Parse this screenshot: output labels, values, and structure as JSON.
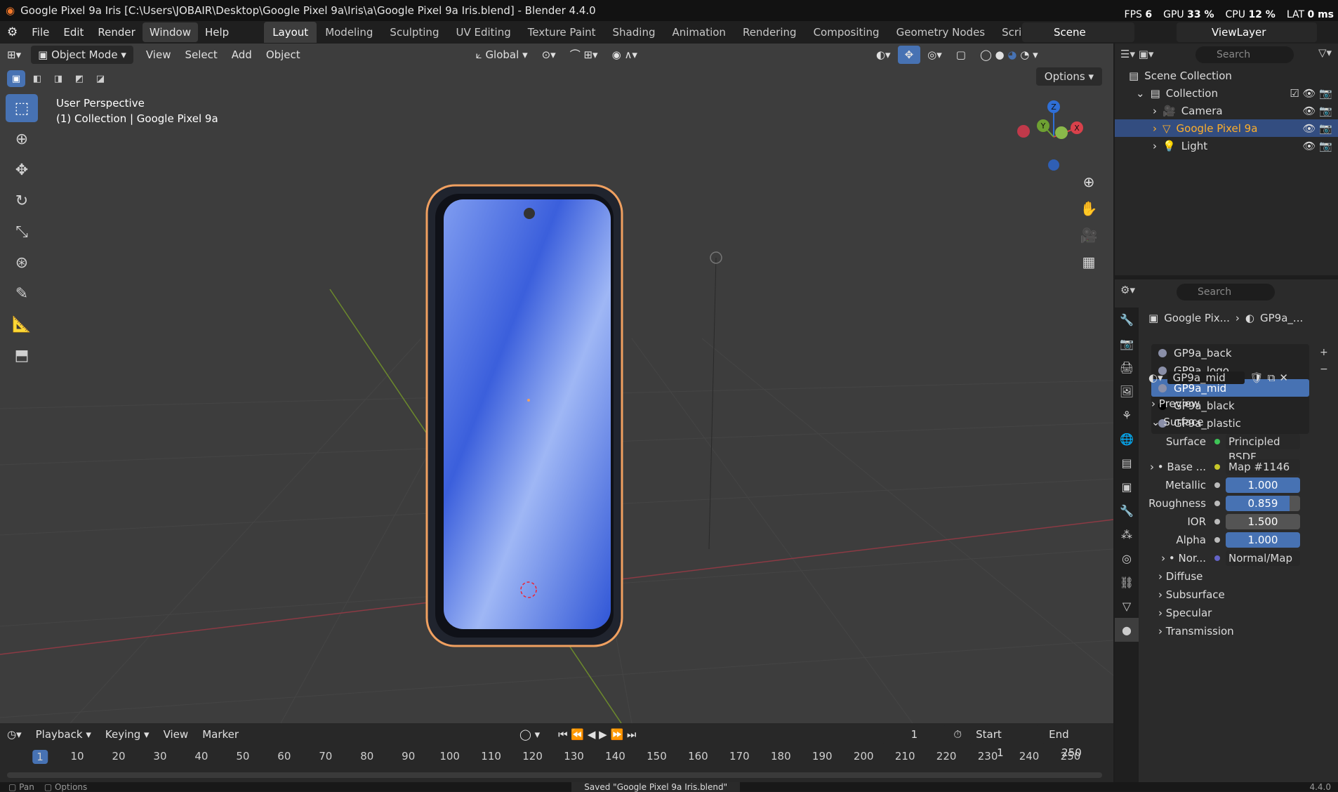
{
  "title_bar": {
    "title": "Google Pixel 9a Iris [C:\\Users\\JOBAIR\\Desktop\\Google Pixel 9a\\Iris\\a\\Google Pixel 9a Iris.blend] - Blender 4.4.0",
    "fps_label": "FPS",
    "fps_value": "6",
    "gpu_label": "GPU",
    "gpu_value": "33 %",
    "cpu_label": "CPU",
    "cpu_value": "12 %",
    "lat_label": "LAT",
    "lat_value": "0 ms"
  },
  "menu": {
    "items": [
      "File",
      "Edit",
      "Render",
      "Window",
      "Help"
    ],
    "active": "Window"
  },
  "workspaces": {
    "tabs": [
      "Layout",
      "Modeling",
      "Sculpting",
      "UV Editing",
      "Texture Paint",
      "Shading",
      "Animation",
      "Rendering",
      "Compositing",
      "Geometry Nodes",
      "Scripting"
    ],
    "active": "Layout",
    "add": "+"
  },
  "scene": {
    "name": "Scene",
    "view_layer": "ViewLayer"
  },
  "viewport_header": {
    "mode": "Object Mode",
    "menus": [
      "View",
      "Select",
      "Add",
      "Object"
    ],
    "orientation": "Global",
    "options": "Options"
  },
  "viewport": {
    "perspective": "User Perspective",
    "collection_line": "(1) Collection | Google Pixel 9a",
    "gizmo": {
      "z": "Z",
      "y": "Y",
      "x": "X"
    }
  },
  "timeline": {
    "menus": [
      "Playback",
      "Keying",
      "View",
      "Marker"
    ],
    "current_frame": "1",
    "start_label": "Start",
    "start": "1",
    "end_label": "End",
    "end": "250",
    "ruler": [
      "1",
      "10",
      "20",
      "30",
      "40",
      "50",
      "60",
      "70",
      "80",
      "90",
      "100",
      "110",
      "120",
      "130",
      "140",
      "150",
      "160",
      "170",
      "180",
      "190",
      "200",
      "210",
      "220",
      "230",
      "240",
      "250"
    ]
  },
  "status_bar": {
    "pan": "Pan",
    "options": "Options",
    "message": "Saved \"Google Pixel 9a Iris.blend\"",
    "version": "4.4.0"
  },
  "outliner": {
    "search_placeholder": "Search",
    "scene_collection": "Scene Collection",
    "collection": "Collection",
    "items": [
      "Camera",
      "Google Pixel 9a",
      "Light"
    ],
    "selected": "Google Pixel 9a"
  },
  "properties": {
    "search_placeholder": "Search",
    "breadcrumb_object": "Google Pix...",
    "breadcrumb_material": "GP9a_...",
    "materials": [
      {
        "name": "GP9a_back",
        "color": "#8a8fa8"
      },
      {
        "name": "GP9a_logo",
        "color": "#8a8fa8"
      },
      {
        "name": "GP9a_mid",
        "color": "#8a8fa8"
      },
      {
        "name": "GP9a_black",
        "color": "#000000"
      },
      {
        "name": "GP9a_plastic",
        "color": "#8a8fa8"
      }
    ],
    "selected_material": "GP9a_mid",
    "material_field": "GP9a_mid",
    "preview": "Preview",
    "surface_section": "Surface",
    "surface_label": "Surface",
    "surface_value": "Principled BSDF",
    "base_label": "Base ...",
    "base_value": "Map #1146",
    "metallic_label": "Metallic",
    "metallic": "1.000",
    "roughness_label": "Roughness",
    "roughness": "0.859",
    "ior_label": "IOR",
    "ior": "1.500",
    "alpha_label": "Alpha",
    "alpha": "1.000",
    "normal_label": "Nor...",
    "normal_value": "Normal/Map",
    "subsections": [
      "Diffuse",
      "Subsurface",
      "Specular",
      "Transmission"
    ]
  },
  "colors": {
    "accent": "#4772b3",
    "selected_object": "#ffaf29"
  }
}
